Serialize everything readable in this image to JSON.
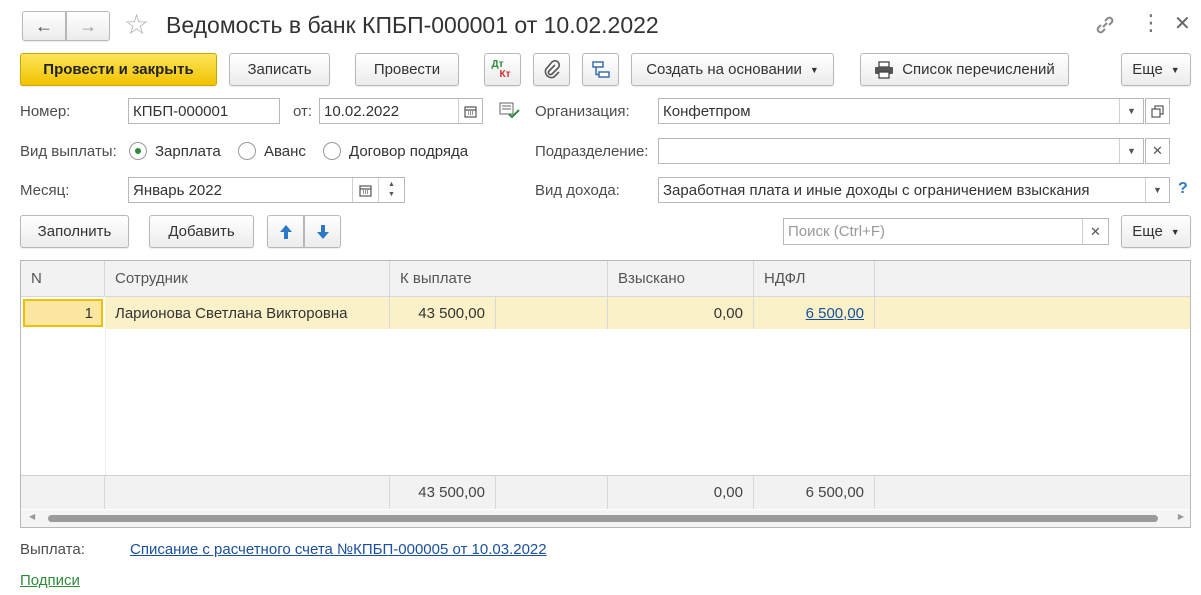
{
  "window": {
    "title": "Ведомость в банк КПБП-000001 от 10.02.2022"
  },
  "toolbar": {
    "post_close": "Провести и закрыть",
    "save": "Записать",
    "post": "Провести",
    "dtkt_top": "Дт",
    "dtkt_bottom": "Кт",
    "create_based": "Создать на основании",
    "print_list": "Список перечислений",
    "more": "Еще"
  },
  "form": {
    "number_label": "Номер:",
    "number_value": "КПБП-000001",
    "date_label": "от:",
    "date_value": "10.02.2022",
    "org_label": "Организация:",
    "org_value": "Конфетпром",
    "pay_type_label": "Вид выплаты:",
    "pay_types": [
      "Зарплата",
      "Аванс",
      "Договор подряда"
    ],
    "pay_type_selected": "Зарплата",
    "division_label": "Подразделение:",
    "division_value": "",
    "month_label": "Месяц:",
    "month_value": "Январь 2022",
    "income_label": "Вид дохода:",
    "income_value": "Заработная плата и иные доходы с ограничением взыскания"
  },
  "table_toolbar": {
    "fill": "Заполнить",
    "add": "Добавить",
    "search_placeholder": "Поиск (Ctrl+F)",
    "more": "Еще"
  },
  "table": {
    "columns": [
      "N",
      "Сотрудник",
      "К выплате",
      "Взыскано",
      "НДФЛ"
    ],
    "rows": [
      {
        "n": "1",
        "employee": "Ларионова Светлана Викторовна",
        "to_pay": "43 500,00",
        "blank": "",
        "collected": "0,00",
        "ndfl": "6 500,00"
      }
    ],
    "totals": {
      "to_pay": "43 500,00",
      "collected": "0,00",
      "ndfl": "6 500,00"
    }
  },
  "footer": {
    "payment_label": "Выплата:",
    "payment_link": "Списание с расчетного счета №КПБП-000005 от 10.03.2022",
    "signatures_link": "Подписи"
  },
  "colors": {
    "primary_button": "#f5cd14",
    "selected_row": "#fbf1c8",
    "link": "#1a4f9c",
    "signatures_link": "#2e8b3a"
  }
}
